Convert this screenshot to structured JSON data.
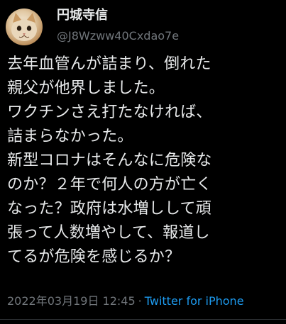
{
  "tweet": {
    "author": {
      "display_name": "円城寺信",
      "handle": "@J8Wzww40Cxdao7e",
      "avatar_icon": "cat-avatar-icon"
    },
    "text": "去年血管んが詰まり、倒れた\n親父が他界しました。\nワクチンさえ打たなければ、\n詰まらなかった。\n新型コロナはそんなに危険な\nのか？２年で何人の方が亡く\nなった？政府は水増しして頑\n張って人数増やして、報道し\nてるが危険を感じるか？",
    "timestamp": "2022年03月19日 12:45",
    "separator": "·",
    "source": "Twitter for iPhone"
  },
  "colors": {
    "background": "#000000",
    "text_primary": "#e7e9ea",
    "text_secondary": "#71767b",
    "link": "#1d9bf0"
  }
}
